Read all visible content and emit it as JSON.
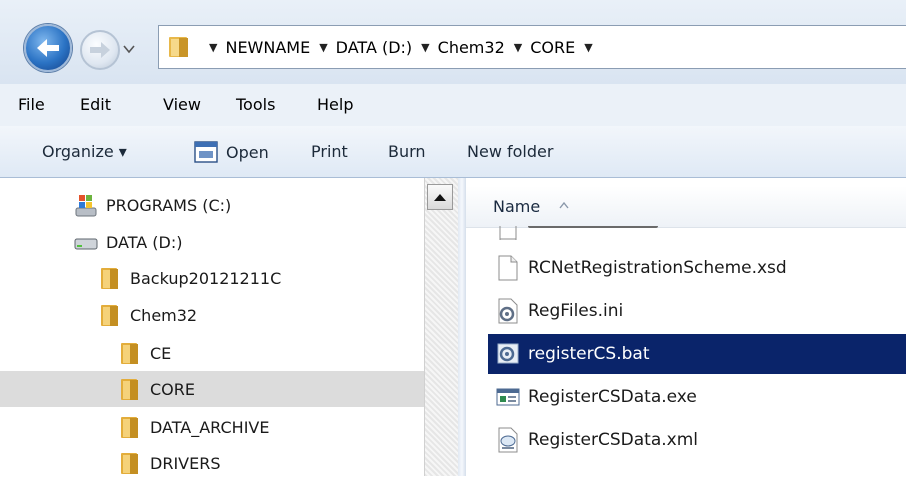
{
  "address_bar": {
    "breadcrumb": [
      "NEWNAME",
      "DATA (D:)",
      "Chem32",
      "CORE"
    ]
  },
  "menu": {
    "items": [
      "File",
      "Edit",
      "View",
      "Tools",
      "Help"
    ]
  },
  "command_bar": {
    "organize": "Organize ▾",
    "open": "Open",
    "print": "Print",
    "burn": "Burn",
    "new_folder": "New folder"
  },
  "nav_tree": {
    "items": [
      {
        "label": "PROGRAMS (C:)",
        "icon": "windows-drive-icon"
      },
      {
        "label": "DATA (D:)",
        "icon": "hard-drive-icon"
      },
      {
        "label": "Backup20121211C",
        "icon": "folder-icon"
      },
      {
        "label": "Chem32",
        "icon": "folder-icon"
      },
      {
        "label": "CE",
        "icon": "folder-icon"
      },
      {
        "label": "CORE",
        "icon": "folder-icon",
        "selected": true
      },
      {
        "label": "DATA_ARCHIVE",
        "icon": "folder-icon"
      },
      {
        "label": "DRIVERS",
        "icon": "folder-icon"
      }
    ]
  },
  "file_list": {
    "column_name": "Name",
    "files": [
      {
        "name": "RCNetRegistrationScheme.xsd",
        "icon": "blank-file-icon"
      },
      {
        "name": "RegFiles.ini",
        "icon": "settings-file-icon"
      },
      {
        "name": "registerCS.bat",
        "icon": "batch-file-icon",
        "selected": true
      },
      {
        "name": "RegisterCSData.exe",
        "icon": "exe-file-icon"
      },
      {
        "name": "RegisterCSData.xml",
        "icon": "xml-file-icon"
      }
    ]
  },
  "colors": {
    "selection": "#0a246a",
    "tree_selection": "#dcdcdc",
    "folder": "#e8b84a"
  }
}
